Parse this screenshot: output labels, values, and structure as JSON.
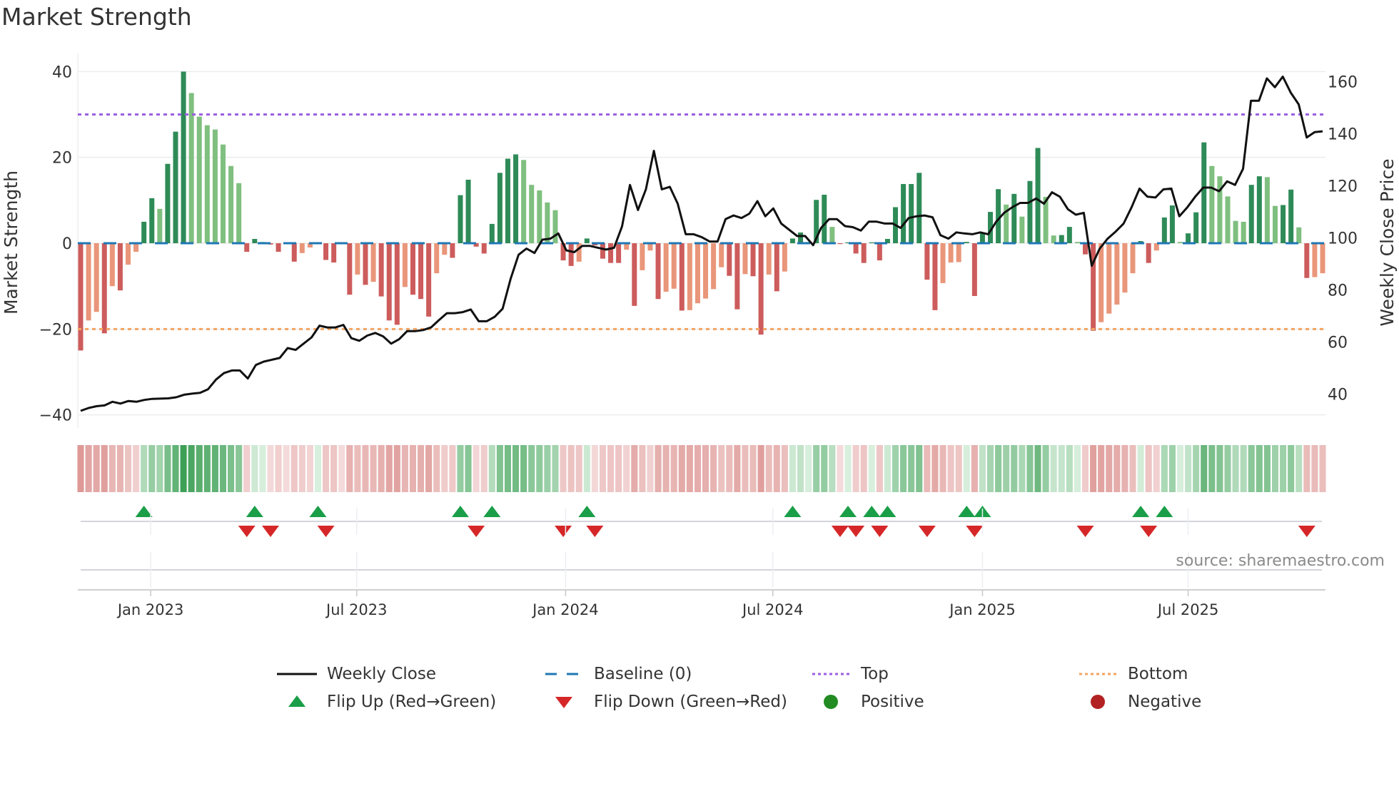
{
  "title": "Market Strength",
  "source": "source: sharemaestro.com",
  "legend": {
    "weekly_close": "Weekly Close",
    "baseline": "Baseline (0)",
    "top": "Top",
    "bottom": "Bottom",
    "flip_up": "Flip Up (Red→Green)",
    "flip_down": "Flip Down (Green→Red)",
    "positive": "Positive",
    "negative": "Negative"
  },
  "colors": {
    "green_dark": "#2e8b57",
    "green_light": "#7fbf7f",
    "red_dark": "#cd5c5c",
    "red_light": "#e9967a",
    "baseline": "#1f77b4",
    "top": "#9b5fe0",
    "bottom": "#f4a460",
    "price": "#111111",
    "flip_up": "#1a9e48",
    "flip_down": "#d62728",
    "positive": "#228b22",
    "negative": "#b22222"
  },
  "chart_data": {
    "type": "bar",
    "title": "Market Strength",
    "ylabel": "Market Strength",
    "y2label": "Weekly Close Price",
    "ylim": [
      -43,
      44
    ],
    "y2lim": [
      29,
      168
    ],
    "yticks": [
      40,
      20,
      0,
      -20,
      -40
    ],
    "y2ticks": [
      160,
      140,
      120,
      100,
      80,
      60,
      40
    ],
    "grid": true,
    "legend_position": "bottom",
    "x_unit": "week index",
    "xticks": [
      {
        "label": "Jan 2023",
        "week": 8.85
      },
      {
        "label": "Jul 2023",
        "week": 34.9
      },
      {
        "label": "Jan 2024",
        "week": 61.3
      },
      {
        "label": "Jul 2024",
        "week": 87.5
      },
      {
        "label": "Jan 2025",
        "week": 114.0
      },
      {
        "label": "Jul 2025",
        "week": 140.0
      }
    ],
    "reference_lines": {
      "baseline": 0,
      "top": 30,
      "bottom": -20
    },
    "strength": [
      -25,
      -18,
      -16,
      -21,
      -10,
      -11,
      -5,
      -2,
      5,
      10.5,
      8,
      18.5,
      26,
      40,
      35,
      29.5,
      27.5,
      26.5,
      23,
      18,
      14,
      -2,
      1,
      0.3,
      -0.3,
      -2,
      -0.2,
      -4.3,
      -2.3,
      -1,
      0.2,
      -3.9,
      -4.5,
      -0.2,
      -12,
      -7.3,
      -9.7,
      -9,
      -12.4,
      -18,
      -19,
      -10.2,
      -12,
      -13,
      -17.1,
      -7,
      -2.7,
      -3.4,
      11.2,
      14.8,
      -0.8,
      -2.4,
      4.5,
      16.4,
      19.7,
      20.7,
      19.4,
      13.6,
      12.3,
      9.5,
      7.7,
      -4,
      -5.3,
      -4.3,
      1.1,
      -0.5,
      -3.6,
      -4.6,
      -4.6,
      -1.5,
      -14.6,
      -6.3,
      -1.7,
      -13,
      -11.3,
      -10.6,
      -15.7,
      -15.6,
      -14,
      -12.9,
      -10.7,
      -5.6,
      -7.6,
      -15.4,
      -7.2,
      -7.7,
      -21.3,
      -7.3,
      -11.2,
      -6.6,
      1.1,
      2.5,
      0.3,
      10.1,
      11.3,
      3.8,
      -0.2,
      0.2,
      -2.4,
      -4.6,
      0.2,
      -4,
      1,
      8.4,
      13.8,
      13.8,
      16.4,
      -8.5,
      -15.6,
      -9.3,
      -4.5,
      -4.4,
      0.3,
      -12.3,
      2.5,
      7.3,
      12.6,
      9,
      11.5,
      6.2,
      14.5,
      22.2,
      10.8,
      1.8,
      1.9,
      3.8,
      0.3,
      -2.6,
      -20.4,
      -18.4,
      -16.4,
      -14.3,
      -11.5,
      -7,
      0.5,
      -4.6,
      -1.7,
      6,
      8.8,
      0.3,
      2.3,
      7.2,
      23.5,
      18,
      15.6,
      10.9,
      5.2,
      5,
      13.6,
      15.6,
      15.4,
      8.7,
      8.9,
      12.5,
      3.7,
      -8.1,
      -7.9,
      -7
    ],
    "weekly_close": [
      33.6,
      34.7,
      35.4,
      35.7,
      37.1,
      36.4,
      37.4,
      37.1,
      37.8,
      38.2,
      38.3,
      38.4,
      38.8,
      39.8,
      40.2,
      40.5,
      41.9,
      45.6,
      48.1,
      49.1,
      49.1,
      46.0,
      51.2,
      52.5,
      53.2,
      53.9,
      57.7,
      57.0,
      59.4,
      61.8,
      66.3,
      65.6,
      65.6,
      66.6,
      61.5,
      60.5,
      62.5,
      63.5,
      62.2,
      59.4,
      61.1,
      64.2,
      64.2,
      64.6,
      65.6,
      68.4,
      71.1,
      71.1,
      71.5,
      72.5,
      68.0,
      68.0,
      69.7,
      72.8,
      84.2,
      93.5,
      95.9,
      94.2,
      99.3,
      99.7,
      101.7,
      95.2,
      94.5,
      96.9,
      96.9,
      96.2,
      95.5,
      96.2,
      104.4,
      120.3,
      110.7,
      118.6,
      133.4,
      118.6,
      119.6,
      113.1,
      101.4,
      101.4,
      100.3,
      98.6,
      98.6,
      107.2,
      108.6,
      107.6,
      109.3,
      114.1,
      108.3,
      111.3,
      105.5,
      103.1,
      100.7,
      100.7,
      97.2,
      103.8,
      107.2,
      107.2,
      104.5,
      104.1,
      102.8,
      106.2,
      106.2,
      105.5,
      105.5,
      103.8,
      107.6,
      108.3,
      108.6,
      107.9,
      101.0,
      99.7,
      102.1,
      101.7,
      101.4,
      102.1,
      101.4,
      106.2,
      109.6,
      111.7,
      113.4,
      113.4,
      115.1,
      113.1,
      117.5,
      115.8,
      111.0,
      108.9,
      109.6,
      89.3,
      95.9,
      99.7,
      102.4,
      105.5,
      111.7,
      118.9,
      115.8,
      115.5,
      118.6,
      118.9,
      108.3,
      111.7,
      115.8,
      119.3,
      119.3,
      117.9,
      121.7,
      120.3,
      126.5,
      152.6,
      152.6,
      161.2,
      157.8,
      161.9,
      155.7,
      151.2,
      138.5,
      140.6,
      140.9
    ],
    "flip_up_weeks": [
      8,
      22,
      30,
      48,
      52,
      64,
      90,
      97,
      100,
      102,
      112,
      114,
      134,
      137
    ],
    "flip_down_weeks": [
      21,
      24,
      31,
      50,
      61,
      65,
      96,
      98,
      101,
      107,
      113,
      127,
      135,
      155
    ]
  }
}
